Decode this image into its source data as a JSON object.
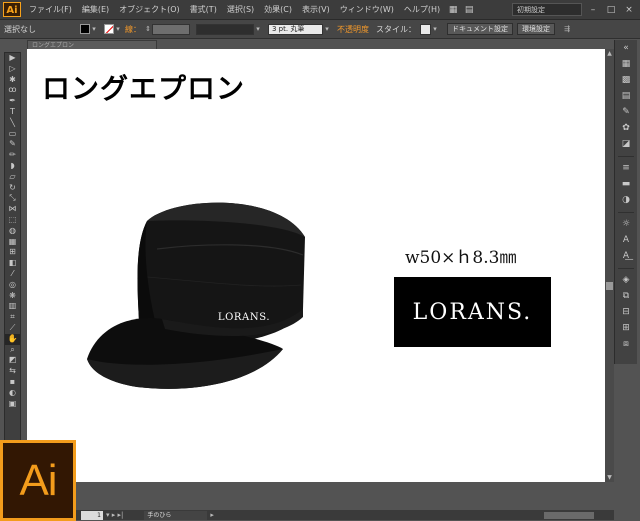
{
  "app": {
    "logo_text": "Ai",
    "accent_color": "#f39c1c"
  },
  "menubar": {
    "items": [
      "ファイル(F)",
      "編集(E)",
      "オブジェクト(O)",
      "書式(T)",
      "選択(S)",
      "効果(C)",
      "表示(V)",
      "ウィンドウ(W)",
      "ヘルプ(H)"
    ],
    "workspace": "初期設定",
    "window_controls": [
      "–",
      "□",
      "×"
    ]
  },
  "controlbar": {
    "selection": "選択なし",
    "stroke_label": "線：",
    "stroke_size": "3 pt. 丸筆",
    "opacity_label": "不透明度",
    "style_label": "スタイル：",
    "doc_setup": "ドキュメント設定",
    "prefs": "環境設定"
  },
  "document": {
    "tab_title": "ロングエプロン",
    "heading": "ロングエプロン",
    "cap_logo": "LORANS.",
    "dimensions": "w50×ｈ8.3㎜",
    "logo_box_text": "LORANS."
  },
  "statusbar": {
    "zoom": "1",
    "tool_name": "手のひら"
  },
  "colors": {
    "menubar": "#3c3c3c",
    "controlbar": "#464646",
    "canvas": "#ffffff",
    "logo_box": "#000000",
    "ai_logo_bg": "#321703"
  }
}
